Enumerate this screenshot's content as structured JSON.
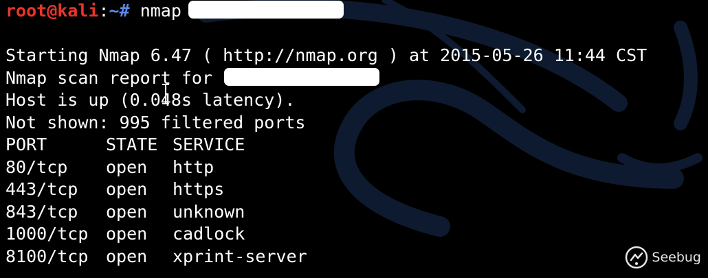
{
  "prompt": {
    "user": "root@kali",
    "separator": ":",
    "path": "~#",
    "command": "nmap"
  },
  "output": {
    "starting": "Starting Nmap 6.47 ( http://nmap.org ) at 2015-05-26 11:44 CST",
    "scan_report": "Nmap scan report for",
    "host_up": "Host is up (0.048s latency).",
    "not_shown": "Not shown: 995 filtered ports"
  },
  "table": {
    "headers": [
      "PORT",
      "STATE",
      "SERVICE"
    ],
    "rows": [
      [
        "80/tcp",
        "open",
        "http"
      ],
      [
        "443/tcp",
        "open",
        "https"
      ],
      [
        "843/tcp",
        "open",
        "unknown"
      ],
      [
        "1000/tcp",
        "open",
        "cadlock"
      ],
      [
        "8100/tcp",
        "open",
        "xprint-server"
      ]
    ]
  },
  "watermark": {
    "text": "Seebug",
    "icon": "seebug-logo-icon"
  },
  "colors": {
    "background": "#000000",
    "text": "#ffffff",
    "prompt_user": "#e8352b",
    "prompt_path": "#5d8ae8",
    "swoosh": "#0e1a2f"
  }
}
